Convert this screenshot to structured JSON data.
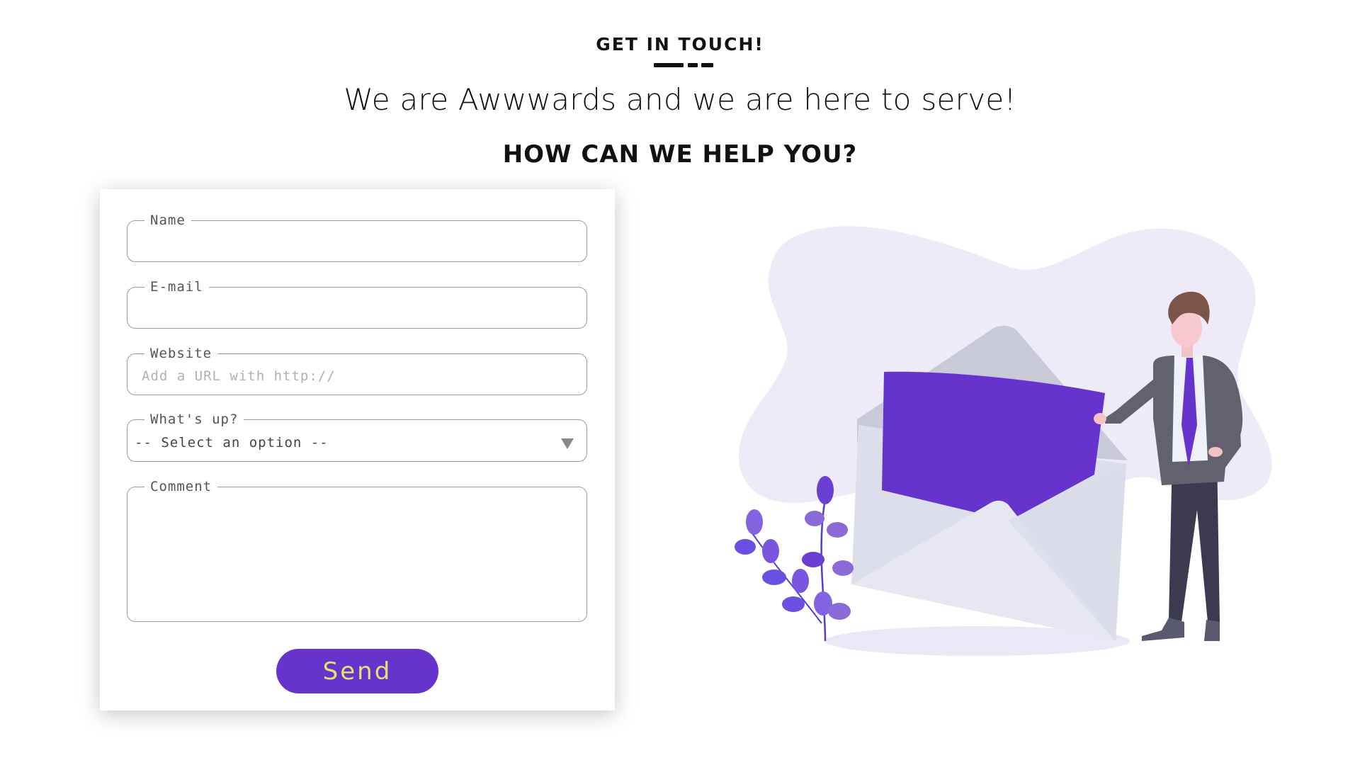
{
  "header": {
    "kicker": "GET IN TOUCH!",
    "subtitle": "We are Awwwards and we are here to serve!",
    "heading": "HOW CAN WE HELP YOU?"
  },
  "form": {
    "name": {
      "label": "Name",
      "value": ""
    },
    "email": {
      "label": "E-mail",
      "value": ""
    },
    "website": {
      "label": "Website",
      "placeholder": "Add a URL with http://",
      "value": ""
    },
    "whats_up": {
      "label": "What's up?",
      "selected": "-- Select an option --"
    },
    "comment": {
      "label": "Comment",
      "value": ""
    },
    "send_label": "Send"
  },
  "illustration": {
    "icons": [
      "contact-illustration",
      "envelope-icon",
      "person-figure",
      "plant-icon"
    ]
  },
  "colors": {
    "accent": "#6634cd",
    "button_text": "#e7e06a",
    "blob": "#eeeaf8",
    "text": "#111111"
  }
}
